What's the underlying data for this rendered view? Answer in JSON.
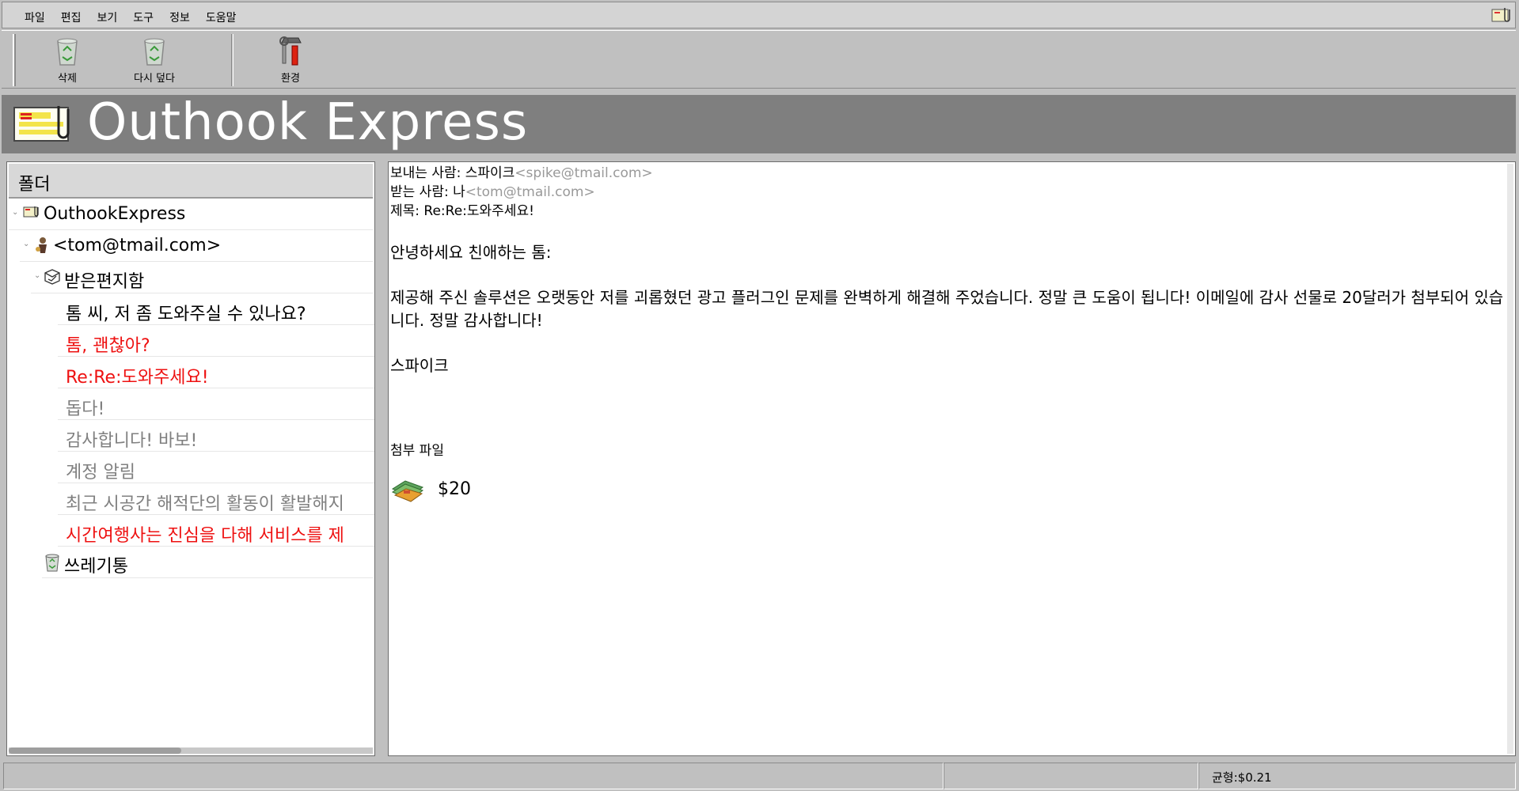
{
  "menu": {
    "items": [
      "파일",
      "편집",
      "보기",
      "도구",
      "정보",
      "도움말"
    ]
  },
  "toolbar": {
    "delete_label": "삭제",
    "reply_label": "다시 덮다",
    "settings_label": "환경"
  },
  "banner": {
    "title": "Outhook Express"
  },
  "folders": {
    "header": "폴더",
    "root": "OuthookExpress",
    "account": "<tom@tmail.com>",
    "inbox": "받은편지함",
    "trash": "쓰레기통",
    "messages": [
      {
        "subject": "톰 씨, 저 좀 도와주실 수 있나요?",
        "color": "#000000"
      },
      {
        "subject": "톰, 괜찮아?",
        "color": "#ee1111"
      },
      {
        "subject": "Re:Re:도와주세요!",
        "color": "#ee1111"
      },
      {
        "subject": "돕다!",
        "color": "#808080"
      },
      {
        "subject": "감사합니다! 바보!",
        "color": "#808080"
      },
      {
        "subject": "계정 알림",
        "color": "#808080"
      },
      {
        "subject": "최근 시공간 해적단의 활동이 활발해지",
        "color": "#808080"
      },
      {
        "subject": "시간여행사는 진심을 다해 서비스를 제",
        "color": "#ee1111"
      }
    ]
  },
  "message": {
    "from_label": "보내는 사람: 스파이크",
    "from_email": "<spike@tmail.com>",
    "to_label": "받는 사람: 나",
    "to_email": "<tom@tmail.com>",
    "subject_line": "제목: Re:Re:도와주세요!",
    "greeting": "안녕하세요 친애하는 톰:",
    "body": "제공해 주신 솔루션은 오랫동안 저를 괴롭혔던 광고 플러그인 문제를 완벽하게 해결해 주었습니다. 정말 큰 도움이 됩니다! 이메일에 감사 선물로 20달러가 첨부되어 있습니다. 정말 감사합니다!",
    "signature": "스파이크",
    "attachments_title": "첨부 파일",
    "attachment_amount": "$20"
  },
  "status": {
    "balance": "균형:$0.21"
  }
}
